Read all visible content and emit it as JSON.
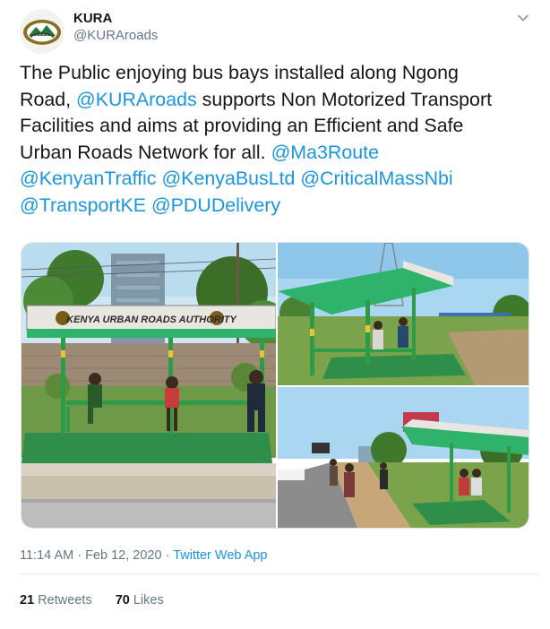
{
  "tweet": {
    "author": {
      "name": "KURA",
      "handle": "@KURAroads"
    },
    "text": {
      "line1": "The Public enjoying bus bays installed along Ngong",
      "line2_a": "Road, ",
      "line2_mention": "@KURAroads",
      "line2_b": " supports Non Motorized Transport",
      "line3": "Facilities and aims at providing an Efficient and Safe",
      "line4_a": "Urban Roads Network for all. ",
      "line4_mention": "@Ma3Route",
      "line5_m1": "@KenyanTraffic",
      "line5_m2": "@KenyaBusLtd",
      "line5_m3": "@CriticalMassNbi",
      "line6_m1": "@TransportKE",
      "line6_m2": "@PDUDelivery"
    },
    "media": {
      "photo1_sign": "KENYA URBAN ROADS AUTHORITY"
    },
    "meta": {
      "time": "11:14 AM",
      "separator": " · ",
      "date": "Feb 12, 2020",
      "app": "Twitter Web App"
    },
    "stats": {
      "retweets_count": "21",
      "retweets_label": "Retweets",
      "likes_count": "70",
      "likes_label": "Likes"
    }
  },
  "icons": {
    "menu": "chevron-down-icon",
    "avatar": "kura-logo"
  },
  "colors": {
    "link": "#1b95e0",
    "text": "#14171a",
    "secondary": "#657786",
    "shelter_roof": "#2fb36b",
    "carpet": "#2f8f4a"
  }
}
